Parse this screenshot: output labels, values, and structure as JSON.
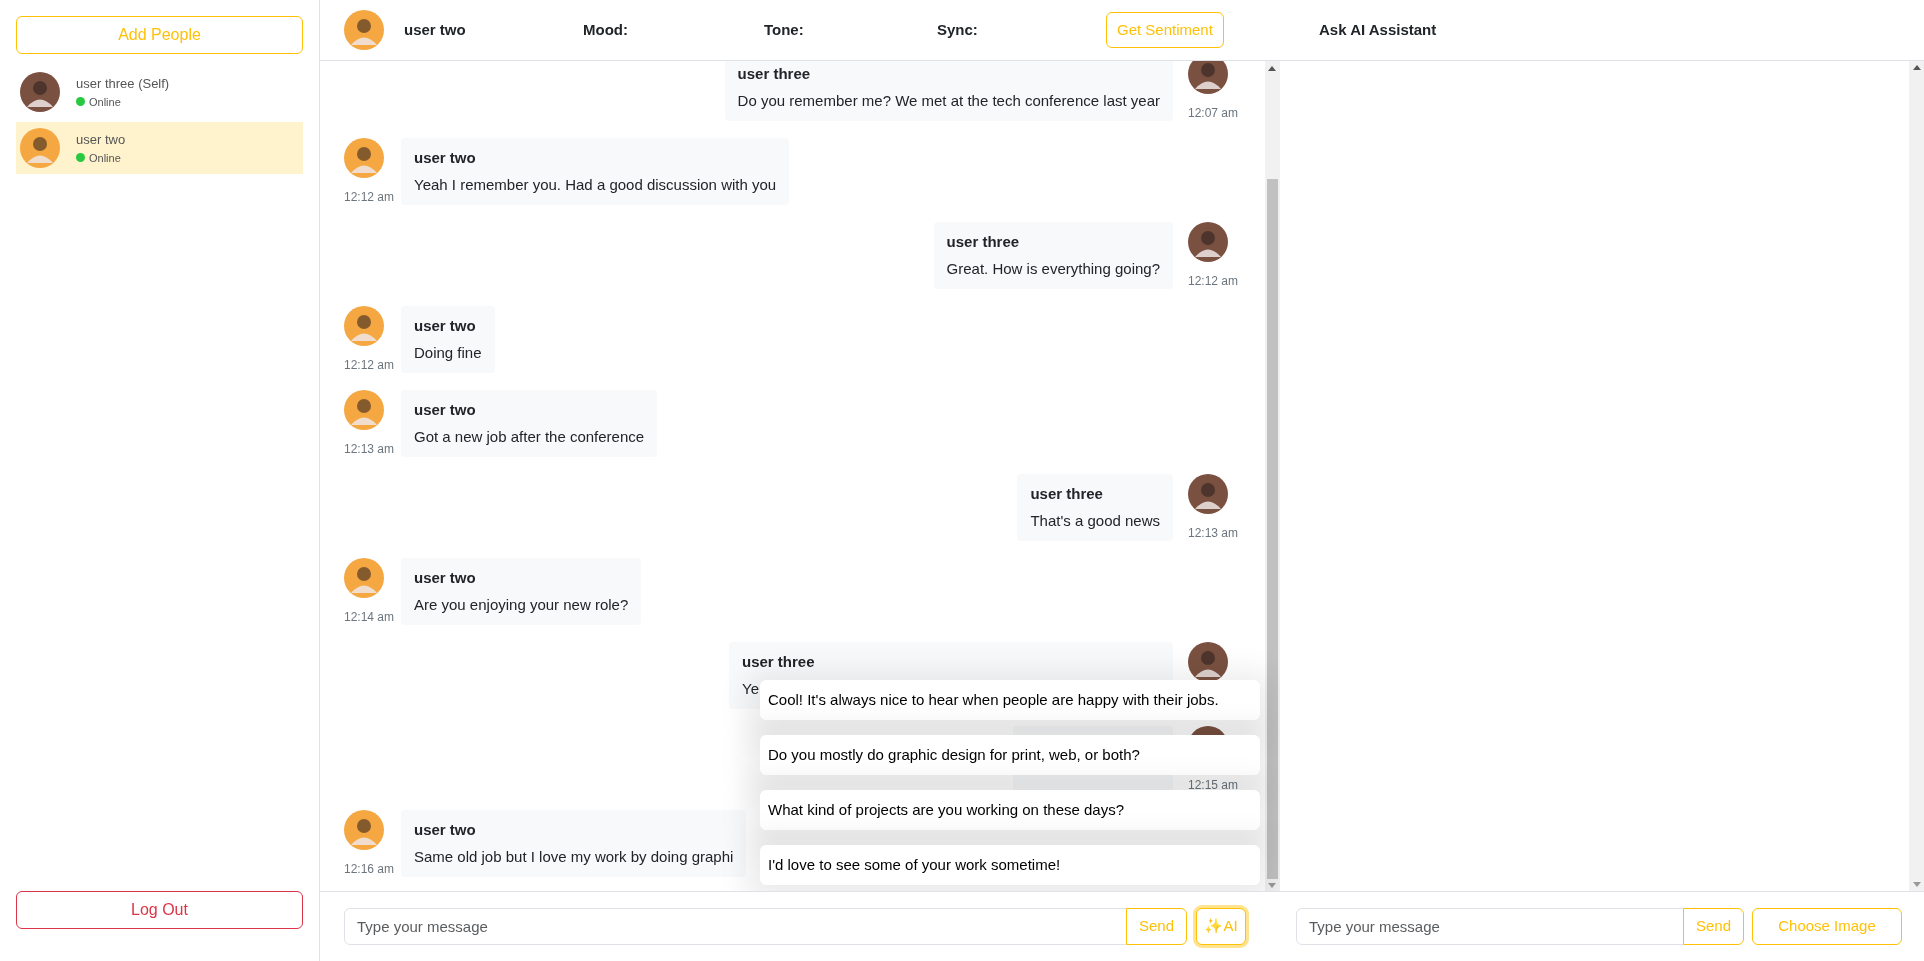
{
  "sidebar": {
    "add_button": "Add People",
    "contacts": [
      {
        "name": "user three (Self)",
        "status": "Online",
        "color": "#7a5140",
        "selected": false
      },
      {
        "name": "user two",
        "status": "Online",
        "color": "#f5a742",
        "selected": true
      }
    ],
    "logout_button": "Log Out"
  },
  "header": {
    "name": "user two",
    "mood_label": "Mood:",
    "tone_label": "Tone:",
    "sync_label": "Sync:",
    "sentiment_button": "Get Sentiment",
    "assistant_title": "Ask AI Assistant"
  },
  "messages": [
    {
      "kind": "outgoing",
      "sender": "user three",
      "text": "Do you remember me? We met at the tech conference last year",
      "time": "12:07 am"
    },
    {
      "kind": "incoming",
      "sender": "user two",
      "text": "Yeah I remember you. Had a good discussion with you",
      "time": "12:12 am"
    },
    {
      "kind": "outgoing",
      "sender": "user three",
      "text": "Great. How is everything going?",
      "time": "12:12 am"
    },
    {
      "kind": "incoming",
      "sender": "user two",
      "text": "Doing fine",
      "time": "12:12 am"
    },
    {
      "kind": "incoming",
      "sender": "user two",
      "text": "Got a new job after the conference",
      "time": "12:13 am"
    },
    {
      "kind": "outgoing",
      "sender": "user three",
      "text": "That's a good news",
      "time": "12:13 am"
    },
    {
      "kind": "incoming",
      "sender": "user two",
      "text": "Are you enjoying your new role?",
      "time": "12:14 am"
    },
    {
      "kind": "outgoing",
      "sender": "user three",
      "text": "Ye",
      "covered": true
    },
    {
      "kind": "outgoing",
      "time": "12:15 am",
      "covered": true
    },
    {
      "kind": "incoming",
      "sender": "user two",
      "text": "Same old job but I love my work by doing graphi",
      "time": "12:16 am"
    }
  ],
  "suggestions": [
    "Cool! It's always nice to hear when people are happy with their jobs.",
    "Do you mostly do graphic design for print, web, or both?",
    "What kind of projects are you working on these days?",
    "I'd love to see some of your work sometime!"
  ],
  "composer": {
    "placeholder": "Type your message",
    "send_button": "Send",
    "ai_button": "✨AI"
  },
  "assistant_composer": {
    "placeholder": "Type your message",
    "send_button": "Send",
    "image_button": "Choose Image"
  }
}
